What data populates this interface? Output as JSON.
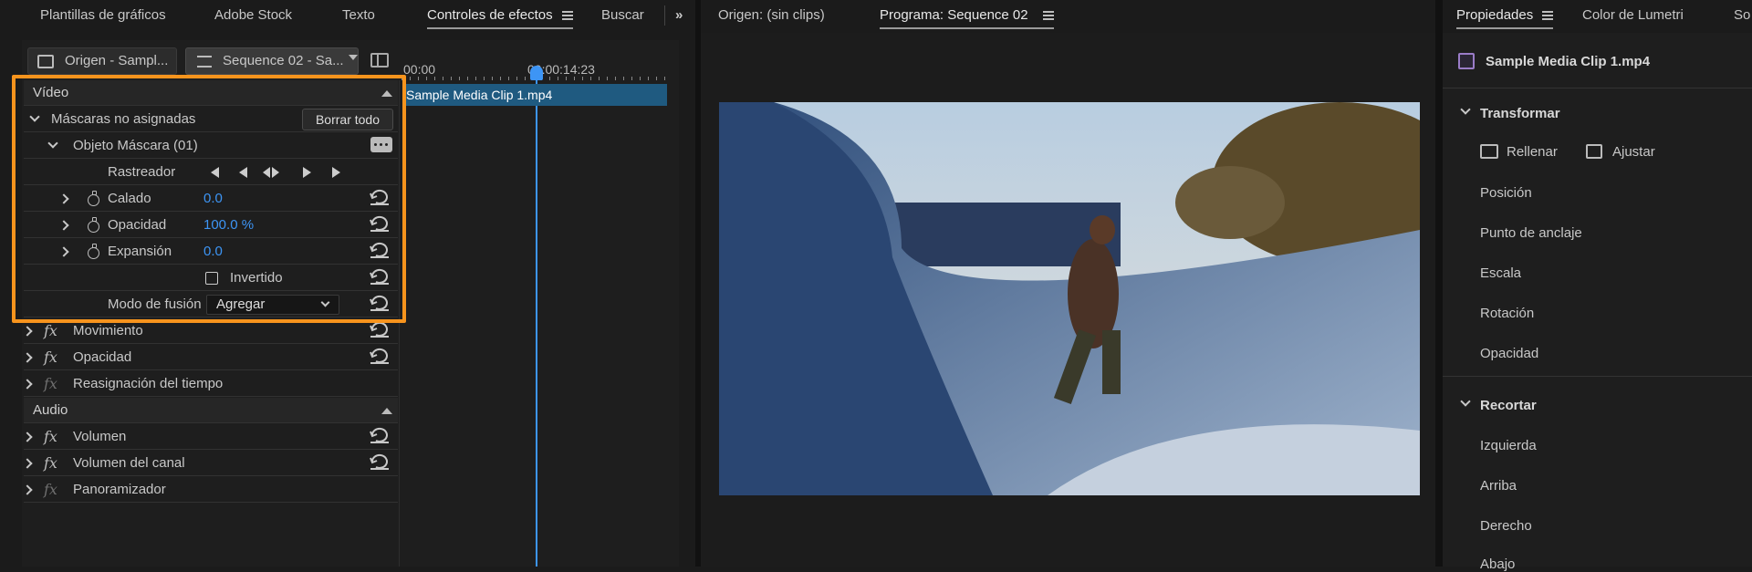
{
  "top_tabs": {
    "left": [
      "Plantillas de gráficos",
      "Adobe Stock",
      "Texto",
      "Controles de efectos",
      "Buscar"
    ],
    "active_left": "Controles de efectos",
    "monitor": [
      "Origen: (sin clips)",
      "Programa: Sequence 02"
    ],
    "right": [
      "Propiedades",
      "Color de Lumetri",
      "So"
    ]
  },
  "effect_controls": {
    "source_tab": "Origen - Sampl...",
    "sequence_tab": "Sequence 02 - Sa...",
    "timecode_start": "00:00",
    "timecode_end": "00:00:14:23",
    "clip_name": "Sample Media Clip 1.mp4",
    "video_header": "Vídeo",
    "unassigned_masks": "Máscaras no asignadas",
    "clear_all": "Borrar todo",
    "mask_object": "Objeto Máscara (01)",
    "tracker": "Rastreador",
    "params": [
      {
        "label": "Calado",
        "value": "0.0"
      },
      {
        "label": "Opacidad",
        "value": "100.0 %"
      },
      {
        "label": "Expansión",
        "value": "0.0"
      }
    ],
    "inverted": "Invertido",
    "blend_mode_label": "Modo de fusión",
    "blend_mode_value": "Agregar",
    "effects_video": [
      "Movimiento",
      "Opacidad",
      "Reasignación del tiempo"
    ],
    "audio_header": "Audio",
    "effects_audio": [
      "Volumen",
      "Volumen del canal",
      "Panoramizador"
    ]
  },
  "properties": {
    "clip": "Sample Media Clip 1.mp4",
    "transform_header": "Transformar",
    "fill": "Rellenar",
    "fit": "Ajustar",
    "transform_items": [
      "Posición",
      "Punto de anclaje",
      "Escala",
      "Rotación",
      "Opacidad"
    ],
    "crop_header": "Recortar",
    "crop_items": [
      "Izquierda",
      "Arriba",
      "Derecho",
      "Abajo"
    ]
  },
  "colors": {
    "highlight": "#f7941d",
    "accent": "#3d95f5",
    "clip_bar": "#1f5a80"
  }
}
